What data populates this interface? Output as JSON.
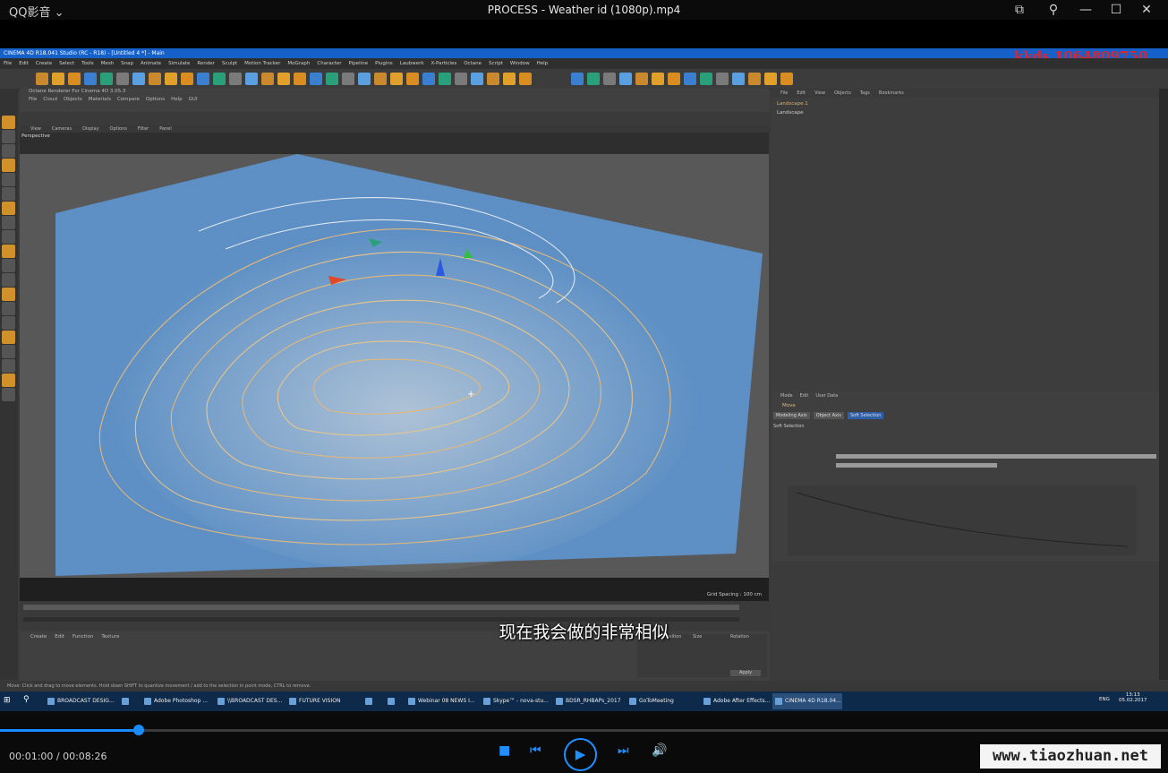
{
  "player": {
    "app_name": "QQ影音",
    "window_title": "PROCESS - Weather id (1080p).mp4",
    "time": "00:01:00 / 00:08:26",
    "progress": 0.119,
    "subtitle": "现在我会做的非常相似",
    "watermark_top": "kkds 1064809750",
    "watermark_site": "www.tiaozhuan.net"
  },
  "c4d": {
    "title": "CINEMA 4D R18.041 Studio (RC - R18) - [Untitled 4 *] - Main",
    "menu": [
      "File",
      "Edit",
      "Create",
      "Select",
      "Tools",
      "Mesh",
      "Snap",
      "Animate",
      "Simulate",
      "Render",
      "Sculpt",
      "Motion Tracker",
      "MoGraph",
      "Character",
      "Pipeline",
      "Plugins",
      "Laubwerk",
      "X-Particles",
      "Octane",
      "Script",
      "Window",
      "Help"
    ],
    "octane_title": "Octane Renderer For Cinema 4D 3.05.3",
    "octane_menu": [
      "File",
      "Cloud",
      "Objects",
      "Materials",
      "Compare",
      "Options",
      "Help",
      "GUI"
    ],
    "viewport_menu": [
      "View",
      "Cameras",
      "Display",
      "Options",
      "Filter",
      "Panel"
    ],
    "viewport_label": "Perspective",
    "grid_spacing": "Grid Spacing : 100 cm",
    "object_menu": [
      "File",
      "Edit",
      "View",
      "Objects",
      "Tags",
      "Bookmarks"
    ],
    "objects": [
      "Landscape.1",
      "Landscape"
    ],
    "attr_menu": [
      "Mode",
      "Edit",
      "User Data"
    ],
    "attr_tabs": [
      "Modeling Axis",
      "Object Axis",
      "Soft Selection"
    ],
    "attr_title": "Move",
    "attr_section": "Soft Selection",
    "coord_headers": [
      "Position",
      "Size",
      "Rotation"
    ],
    "apply_label": "Apply",
    "bottom_menu": [
      "Create",
      "Edit",
      "Function",
      "Texture"
    ],
    "status": "Move: Click and drag to move elements. Hold down SHIFT to quantize movement / add to the selection in point mode, CTRL to remove."
  },
  "taskbar": [
    "BROADCAST DESIG...",
    "",
    "Adobe Photoshop ...",
    "\\\\BROADCAST DES...",
    "FUTURE VISION",
    "",
    "",
    "Webinar 08 NEWS I...",
    "Skype™ - nova-stu...",
    "BDSR_RHBAPs_2017",
    "GoToMeeting",
    "Adobe After Effects...",
    "CINEMA 4D R18.04..."
  ],
  "taskbar_time": "13:13",
  "taskbar_date": "05.02.2017",
  "taskbar_lang": "ENG"
}
